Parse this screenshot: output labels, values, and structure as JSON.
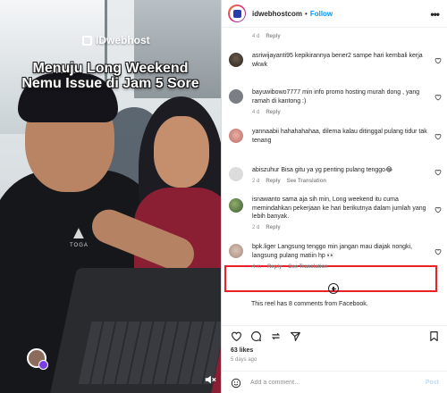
{
  "reel": {
    "brand": "IDwebhost",
    "caption_line1": "Menuju Long Weekend",
    "caption_line2": "Nemu Issue di Jam 5 Sore",
    "tee_brand": "TOGA"
  },
  "header": {
    "username": "idwebhostcom",
    "separator": "•",
    "follow_label": "Follow",
    "more_label": "•••"
  },
  "comments": [
    {
      "user": "",
      "text": "",
      "time": "4 d",
      "reply": "Reply",
      "translation": ""
    },
    {
      "user": "asriwijayanti95",
      "text": "kepikirannya bener2 sampe hari kembali kerja wkwk",
      "time": "4 d",
      "reply": "Reply",
      "translation": ""
    },
    {
      "user": "bayuwibowo7777",
      "text": "min info promo hosting murah dong , yang ramah di kantong :)",
      "time": "4 d",
      "reply": "Reply",
      "translation": ""
    },
    {
      "user": "yannaabii",
      "text": "hahahahahaa, dilema kalau ditinggal pulang tidur tak tenang",
      "time": "4 d",
      "reply": "Reply",
      "translation": ""
    },
    {
      "user": "abiszuhur",
      "text": "Bisa gitu ya yg penting pulang tenggo😂",
      "time": "2 d",
      "reply": "Reply",
      "translation": "See Translation"
    },
    {
      "user": "isnawanto",
      "text": "sama aja sih min, Long weekend itu cuma memindahkan pekerjaan ke hari berikutnya dalam jumlah yang lebih banyak.",
      "time": "2 d",
      "reply": "Reply",
      "translation": ""
    },
    {
      "user": "bpk.liger",
      "text": "Langsung tenggo min jangan mau diajak nongki, langsung pulang matiin hp 👀",
      "time": "4 m",
      "reply": "Reply",
      "translation": "See Translation"
    }
  ],
  "fb_note": "This reel has 8 comments from Facebook.",
  "likes": "63 likes",
  "posted_ago": "5 days ago",
  "composer": {
    "placeholder": "Add a comment…",
    "post_label": "Post"
  },
  "colors": {
    "accent": "#0095f6",
    "highlight": "#e8202a",
    "muted": "#8e8e8e"
  }
}
